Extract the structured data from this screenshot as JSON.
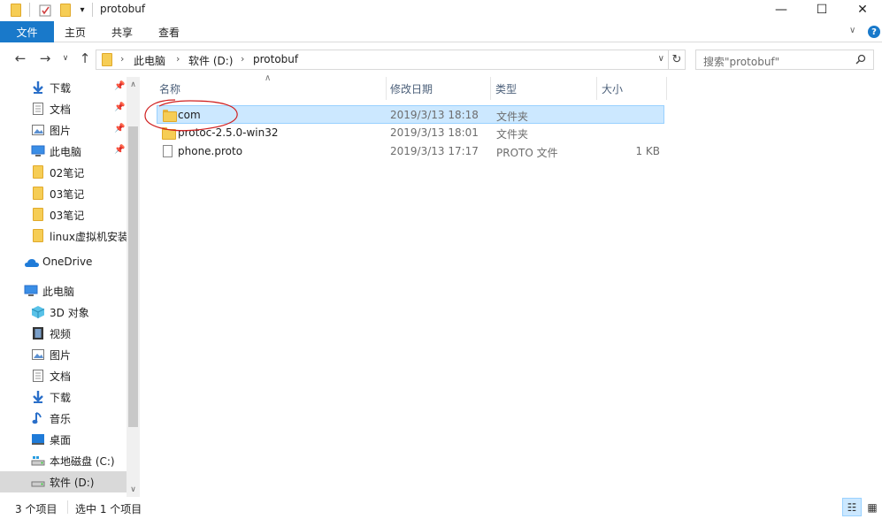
{
  "window": {
    "title": "protobuf"
  },
  "ribbon": {
    "tabs": [
      "文件",
      "主页",
      "共享",
      "查看"
    ]
  },
  "address": {
    "crumbs": [
      "此电脑",
      "软件 (D:)",
      "protobuf"
    ]
  },
  "search": {
    "placeholder": "搜索\"protobuf\""
  },
  "nav": {
    "quick": [
      {
        "label": "下载",
        "icon": "download-icon",
        "pinned": true
      },
      {
        "label": "文档",
        "icon": "document-icon",
        "pinned": true
      },
      {
        "label": "图片",
        "icon": "picture-icon",
        "pinned": true
      },
      {
        "label": "此电脑",
        "icon": "computer-icon",
        "pinned": true
      },
      {
        "label": "02笔记",
        "icon": "folder-icon"
      },
      {
        "label": "03笔记",
        "icon": "folder-icon"
      },
      {
        "label": "03笔记",
        "icon": "folder-icon"
      },
      {
        "label": "linux虚拟机安装",
        "icon": "folder-icon"
      }
    ],
    "onedrive": "OneDrive",
    "thispc": "此电脑",
    "pc_items": [
      {
        "label": "3D 对象",
        "icon": "3d-objects-icon"
      },
      {
        "label": "视频",
        "icon": "video-icon"
      },
      {
        "label": "图片",
        "icon": "picture-icon"
      },
      {
        "label": "文档",
        "icon": "document-icon"
      },
      {
        "label": "下载",
        "icon": "download-icon"
      },
      {
        "label": "音乐",
        "icon": "music-icon"
      },
      {
        "label": "桌面",
        "icon": "desktop-icon"
      },
      {
        "label": "本地磁盘 (C:)",
        "icon": "drive-icon"
      },
      {
        "label": "软件 (D:)",
        "icon": "drive-icon"
      }
    ]
  },
  "columns": {
    "name": "名称",
    "modified": "修改日期",
    "type": "类型",
    "size": "大小"
  },
  "files": [
    {
      "name": "com",
      "modified": "2019/3/13 18:18",
      "type": "文件夹",
      "size": "",
      "icon": "folder-icon",
      "selected": true
    },
    {
      "name": "protoc-2.5.0-win32",
      "modified": "2019/3/13 18:01",
      "type": "文件夹",
      "size": "",
      "icon": "folder-icon",
      "selected": false
    },
    {
      "name": "phone.proto",
      "modified": "2019/3/13 17:17",
      "type": "PROTO 文件",
      "size": "1 KB",
      "icon": "file-icon",
      "selected": false
    }
  ],
  "status": {
    "count": "3 个项目",
    "selected": "选中 1 个项目"
  },
  "colors": {
    "accent": "#1979ca",
    "selection": "#cce8ff",
    "annotation": "#d02020"
  }
}
